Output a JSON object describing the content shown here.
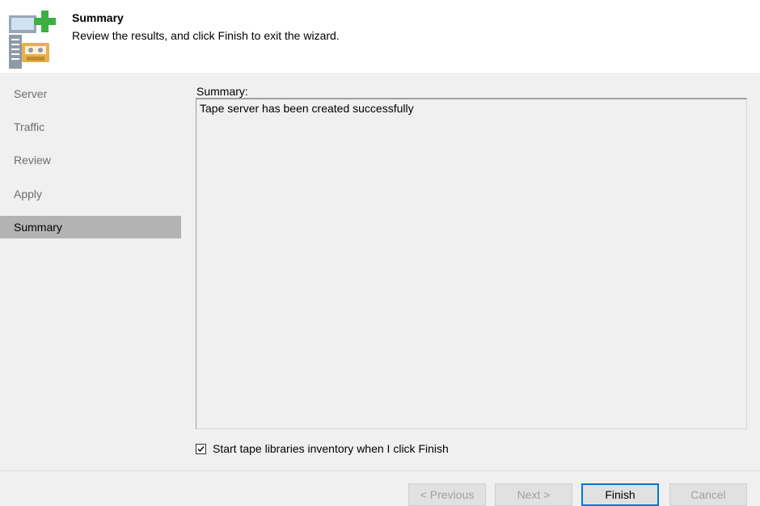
{
  "header": {
    "title": "Summary",
    "subtitle": "Review the results, and click Finish to exit the wizard.",
    "icon": "tape-server-add-icon"
  },
  "steps": [
    {
      "label": "Server",
      "active": false
    },
    {
      "label": "Traffic",
      "active": false
    },
    {
      "label": "Review",
      "active": false
    },
    {
      "label": "Apply",
      "active": false
    },
    {
      "label": "Summary",
      "active": true
    }
  ],
  "main": {
    "summary_label": "Summary:",
    "summary_text": "Tape server has been created successfully",
    "checkbox": {
      "label": "Start tape libraries inventory when I click Finish",
      "checked": true
    }
  },
  "buttons": {
    "previous": "< Previous",
    "next": "Next >",
    "finish": "Finish",
    "cancel": "Cancel"
  },
  "colors": {
    "active_step_bg": "#b3b3b3",
    "primary_button_border": "#0078d7",
    "icon_green": "#3cb043",
    "icon_tape": "#e6b04a"
  }
}
